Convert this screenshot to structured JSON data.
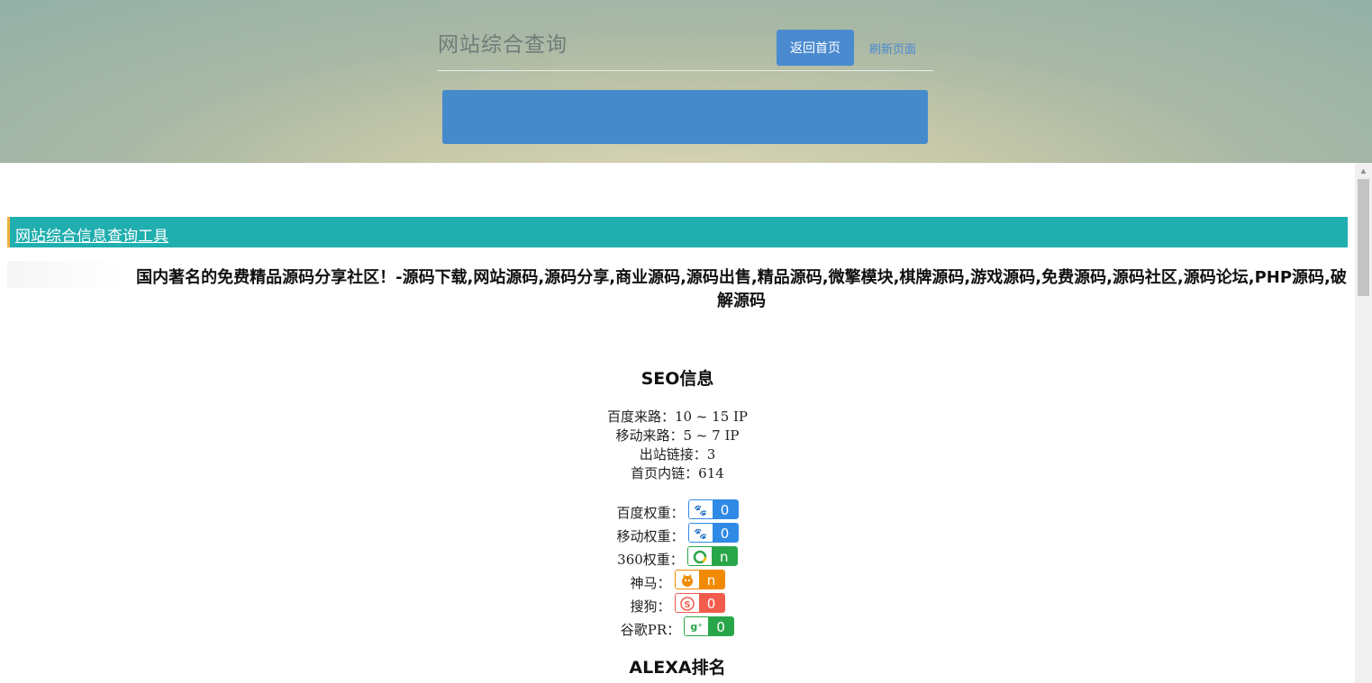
{
  "header": {
    "site_title": "网站综合查询",
    "home_button": "返回首页",
    "refresh_link": "刷新页面"
  },
  "tool": {
    "title": "网站综合信息查询工具"
  },
  "site": {
    "description": "国内著名的免费精品源码分享社区！-源码下载,网站源码,源码分享,商业源码,源码出售,精品源码,微擎模块,棋牌源码,游戏源码,免费源码,源码社区,源码论坛,PHP源码,破解源码"
  },
  "seo": {
    "title": "SEO信息",
    "lines": [
      "百度来路：10 ~ 15 IP",
      "移动来路：5 ~ 7 IP",
      "出站链接：3",
      "首页内链：614"
    ],
    "weights": [
      {
        "label": "百度权重：",
        "value": "0",
        "icon": "baidu-paw-icon",
        "color": "#2f8ae6"
      },
      {
        "label": "移动权重：",
        "value": "0",
        "icon": "baidu-mobile-icon",
        "color": "#2f8ae6"
      },
      {
        "label": "360权重：",
        "value": "n",
        "icon": "360-icon",
        "color": "#2aa64a"
      },
      {
        "label": "神马：",
        "value": "n",
        "icon": "shenma-icon",
        "color": "#f08a00"
      },
      {
        "label": "搜狗：",
        "value": "0",
        "icon": "sogou-icon",
        "color": "#f25c4c"
      },
      {
        "label": "谷歌PR：",
        "value": "0",
        "icon": "google-plus-icon",
        "color": "#2aa64a"
      }
    ]
  },
  "alexa": {
    "title": "ALEXA排名"
  }
}
